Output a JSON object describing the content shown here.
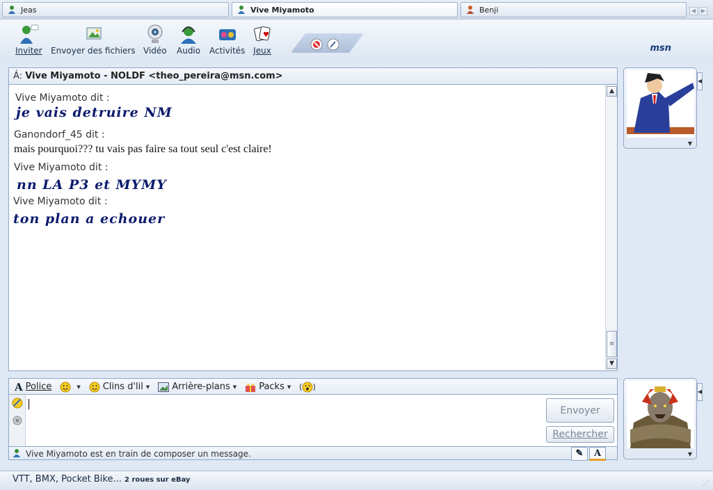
{
  "tabs": [
    {
      "label": "Jeas"
    },
    {
      "label": "Vive Miyamoto"
    },
    {
      "label": "Benji"
    }
  ],
  "toolbar": {
    "invite": "Inviter",
    "send_files": "Envoyer des fichiers",
    "video": "Vidéo",
    "audio": "Audio",
    "activities": "Activités",
    "games": "Jeux",
    "logo": "msn"
  },
  "to_bar": {
    "prefix": "Á:",
    "recipient": "Vive Miyamoto - NOLDF <theo_pereira@msn.com>"
  },
  "conversation": [
    {
      "sender": "Vive Miyamoto dit :",
      "text": "je vais detruire  NM",
      "style": "fancy"
    },
    {
      "sender": "Ganondorf_45 dit :",
      "text": "mais pourquoi??? tu vais pas faire sa tout seul c'est claire!",
      "style": "plain"
    },
    {
      "sender": "Vive Miyamoto dit :",
      "text": "nn  LA P3 et MYMY",
      "style": "fancy"
    },
    {
      "sender": "Vive Miyamoto dit :",
      "text": "ton plan a echouer",
      "style": "fancy"
    }
  ],
  "format_bar": {
    "font": "Police",
    "winks": "Clins d'lil",
    "backgrounds": "Arrière-plans",
    "packs": "Packs"
  },
  "input": {
    "value": "",
    "send_label": "Envoyer",
    "search_label": "Rechercher"
  },
  "status": {
    "typing": "Vive Miyamoto est en train de composer un message."
  },
  "ad": {
    "main": "VTT, BMX, Pocket Bike...",
    "small": "2 roues sur eBay"
  },
  "colors": {
    "fancy_text": "#0b1a6b",
    "frame_border": "#8fa6c4"
  }
}
